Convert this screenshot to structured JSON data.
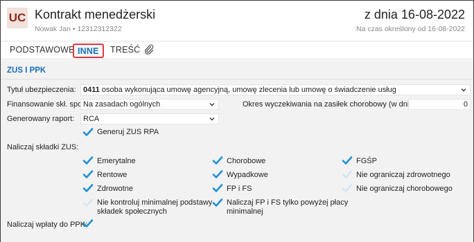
{
  "header": {
    "avatar": "UC",
    "title": "Kontrakt menedżerski",
    "subtitle": "Nowak Jan  •  12312312322",
    "date_title": "z dnia 16-08-2022",
    "date_subtitle": "Na czas określony od 16-08-2022"
  },
  "tabs": [
    {
      "label": "PODSTAWOWE"
    },
    {
      "label": "INNE"
    },
    {
      "label": "TREŚĆ"
    }
  ],
  "attachment_icon": "paperclip-icon",
  "section": {
    "title": "ZUS I PPK",
    "tytul_label": "Tytuł ubezpieczenia:",
    "tytul_code": "0411",
    "tytul_value": " osoba wykonująca umowę agencyjną, umowę zlecenia lub umowę o świadczenie usług",
    "finans_label": "Finansowanie skł. społ.:",
    "finans_value": "Na zasadach ogólnych",
    "okres_label": "Okres wyczekiwania na zasiłek chorobowy (w dniach):",
    "okres_value": "0",
    "raport_label": "Generowany raport:",
    "raport_value": "RCA",
    "generuj_label": "Generuj ZUS RPA",
    "generuj_checked": true,
    "naliczaj_label": "Naliczaj składki ZUS:",
    "skladki": [
      {
        "label": "Emerytalne",
        "checked": true
      },
      {
        "label": "Chorobowe",
        "checked": true
      },
      {
        "label": "FGŚP",
        "checked": true
      },
      {
        "label": "Rentowe",
        "checked": true
      },
      {
        "label": "Wypadkowe",
        "checked": true
      },
      {
        "label": "Nie ograniczaj zdrowotnego",
        "checked": false
      },
      {
        "label": "Zdrowotne",
        "checked": true
      },
      {
        "label": "FP i FS",
        "checked": true
      },
      {
        "label": "Nie ograniczaj chorobowego",
        "checked": false
      }
    ],
    "kontrol_line1": "Nie kontroluj minimalnej podstawy",
    "kontrol_line2": "składek społecznych",
    "kontrol_checked": false,
    "fpfs_line1": "Naliczaj FP i FS tylko powyżej płacy",
    "fpfs_line2": "minimalnej",
    "fpfs_checked": true,
    "ppk_label": "Naliczaj wpłaty do PPK:",
    "ppk_checked": true
  },
  "colors": {
    "accent": "#1a6fb5",
    "check_on": "#1f8fd6",
    "check_off": "#cfe3f2",
    "active_tab_border": "#e03b3b",
    "avatar_bg": "#f2e0db",
    "avatar_text": "#8b2e1b"
  }
}
